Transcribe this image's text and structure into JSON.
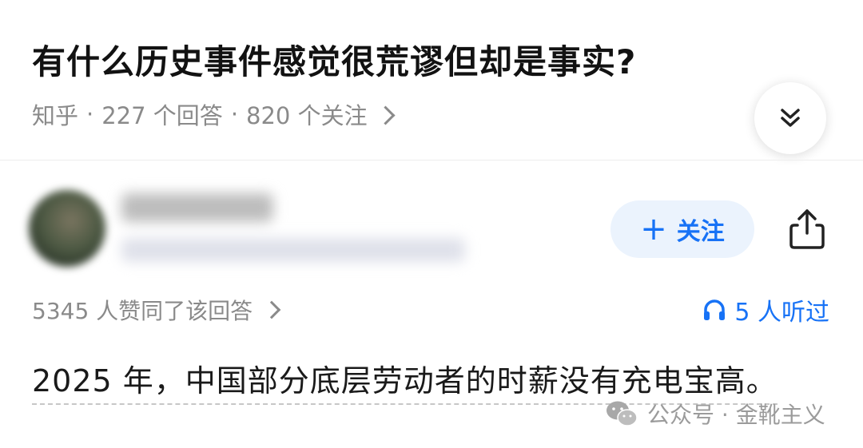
{
  "question": {
    "title": "有什么历史事件感觉很荒谬但却是事实?",
    "source": "知乎",
    "separator": "·",
    "answers_count": "227 个回答",
    "followers_count": "820 个关注"
  },
  "expand_icon": "double-chevron-down-icon",
  "author": {
    "follow_label": "关注",
    "follow_icon": "plus-icon",
    "share_icon": "share-icon"
  },
  "stats": {
    "upvotes": "5345 人赞同了该回答",
    "listen_icon": "headphones-icon",
    "listens": "5 人听过"
  },
  "answer": {
    "text": "2025 年，中国部分底层劳动者的时薪没有充电宝高。"
  },
  "watermark": {
    "icon": "wechat-icon",
    "text": "公众号 · 金靴主义"
  },
  "colors": {
    "accent": "#1772f6",
    "follow_bg": "#ebf3fd",
    "meta_text": "#8a8a8a"
  }
}
